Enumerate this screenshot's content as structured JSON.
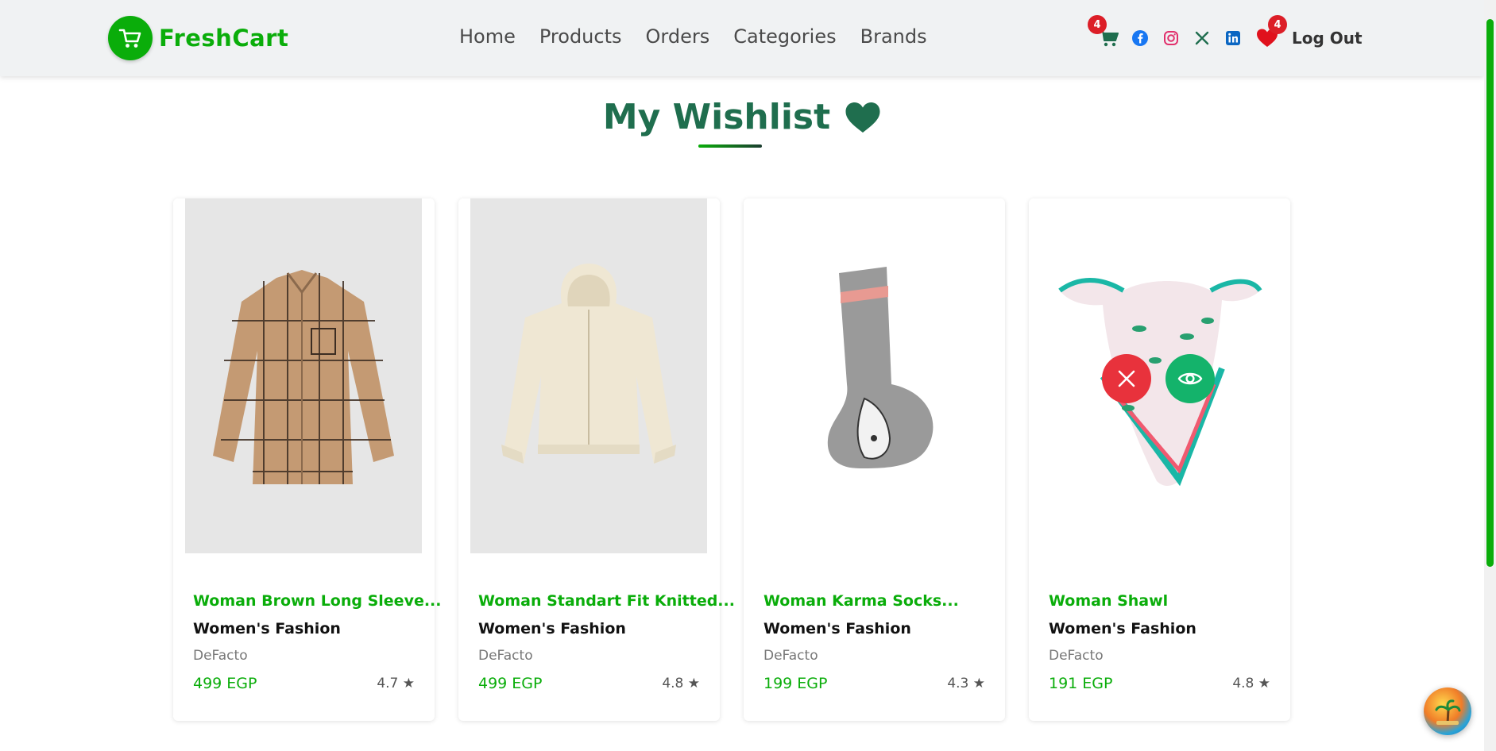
{
  "brand": {
    "name": "FreshCart"
  },
  "nav": {
    "links": [
      "Home",
      "Products",
      "Orders",
      "Categories",
      "Brands"
    ],
    "cart_count": "4",
    "wishlist_count": "4",
    "logout_label": "Log Out"
  },
  "page": {
    "title": "My Wishlist"
  },
  "products": [
    {
      "name": "Woman Brown Long Sleeve...",
      "category": "Women's Fashion",
      "brand": "DeFacto",
      "price": "499 EGP",
      "rating": "4.7 ★"
    },
    {
      "name": "Woman Standart Fit Knitted...",
      "category": "Women's Fashion",
      "brand": "DeFacto",
      "price": "499 EGP",
      "rating": "4.8 ★"
    },
    {
      "name": "Woman Karma Socks...",
      "category": "Women's Fashion",
      "brand": "DeFacto",
      "price": "199 EGP",
      "rating": "4.3 ★"
    },
    {
      "name": "Woman Shawl",
      "category": "Women's Fashion",
      "brand": "DeFacto",
      "price": "191 EGP",
      "rating": "4.8 ★"
    }
  ],
  "colors": {
    "accent": "#0aad0a",
    "title": "#1f6e4e",
    "remove": "#e8323c",
    "view": "#14b36b",
    "badge": "#dc1e27"
  }
}
